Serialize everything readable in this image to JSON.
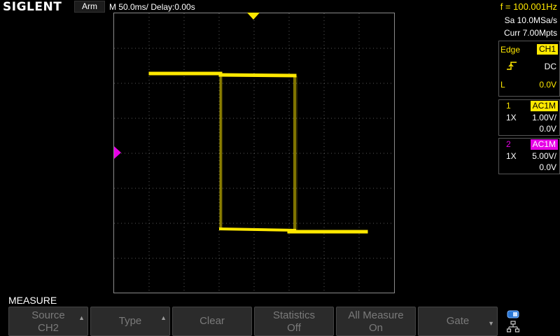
{
  "brand": "SIGLENT",
  "header": {
    "status": "Arm",
    "timebase": "M 50.0ms/ Delay:0.00s",
    "frequency": "f = 100.001Hz"
  },
  "acquisition": {
    "sample_rate": "Sa 10.0MSa/s",
    "memory_depth": "Curr 7.00Mpts"
  },
  "trigger": {
    "type": "Edge",
    "source": "CH1",
    "slope_icon": "rising-edge-icon",
    "coupling": "DC",
    "level_label": "L",
    "level": "0.0V"
  },
  "channels": [
    {
      "number": "1",
      "coupling": "AC1M",
      "probe": "1X",
      "scale": "1.00V/",
      "offset": "0.0V",
      "color": "#ffe800"
    },
    {
      "number": "2",
      "coupling": "AC1M",
      "probe": "1X",
      "scale": "5.00V/",
      "offset": "0.0V",
      "color": "#e600e6"
    }
  ],
  "menu": {
    "title": "MEASURE",
    "softkeys": [
      {
        "line1": "Source",
        "line2": "CH2",
        "arrow": "up"
      },
      {
        "line1": "Type",
        "line2": "",
        "arrow": "up"
      },
      {
        "line1": "Clear",
        "line2": "",
        "arrow": ""
      },
      {
        "line1": "Statistics",
        "line2": "Off",
        "arrow": ""
      },
      {
        "line1": "All Measure",
        "line2": "On",
        "arrow": ""
      },
      {
        "line1": "Gate",
        "line2": "",
        "arrow": "down"
      }
    ]
  },
  "tray_icons": [
    "usb-device-icon",
    "network-icon"
  ],
  "colors": {
    "trace": "#ffe800",
    "ch2": "#e600e6",
    "grid": "#5a5a5a"
  }
}
